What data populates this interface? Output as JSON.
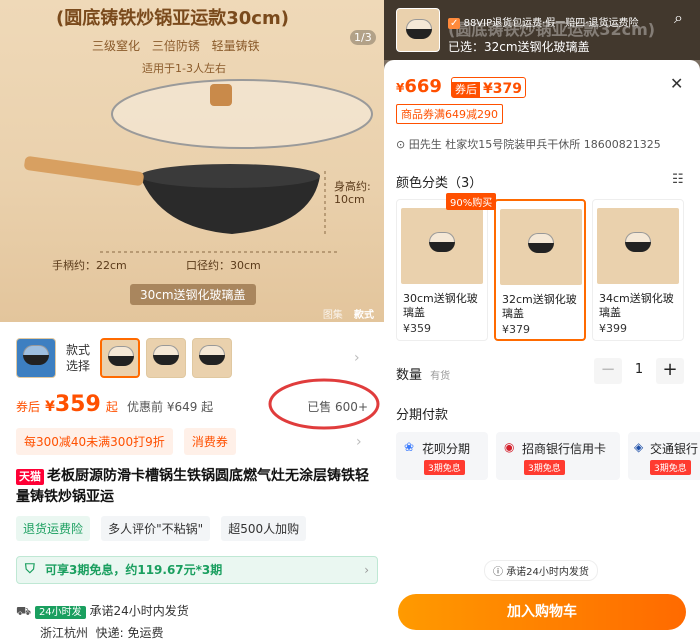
{
  "left": {
    "hero": {
      "title": "(圆底铸铁炒锅亚运款30cm)",
      "features": "三级窒化 三倍防锈 轻量铸铁",
      "suits": "适用于1-3人左右",
      "pager": "1/3",
      "dim_height_label": "身高约:",
      "dim_height_value": "10cm",
      "dim_handle": "手柄约：22cm",
      "dim_mouth": "口径约：30cm",
      "banner": "30cm送钢化玻璃盖",
      "tabs": [
        "图集",
        "款式"
      ]
    },
    "style": {
      "label1": "款式",
      "label2": "选择"
    },
    "price": {
      "after_coupon_label": "券后",
      "currency": "¥",
      "amount": "359",
      "suffix": "起",
      "before_discount": "优惠前 ¥649 起",
      "sold": "已售 600+"
    },
    "promos": [
      "每300减40未满300打9折",
      "消费券"
    ],
    "product_title_badge": "天猫",
    "product_title": "老板厨源防滑卡槽锅生铁锅圆底燃气灶无涂层铸铁轻量铸铁炒锅亚运",
    "tags": [
      "退货运费险",
      "多人评价\"不粘锅\"",
      "超500人加购"
    ],
    "installment": "可享3期免息，约119.67元*3期",
    "shipping": {
      "badge": "24小时发",
      "promise": "承诺24小时内发货",
      "origin": "浙江杭州",
      "express": "快递: 免运费"
    }
  },
  "right": {
    "top": {
      "vip": "88VIP退货包运费·假一赔四·退货运费险",
      "selected": "已选：32cm送钢化玻璃盖",
      "bg_title": "(圆底铸铁炒锅亚运款32cm)"
    },
    "price": {
      "currency": "¥",
      "amount": "669",
      "coupon_label": "券后",
      "coupon_price": "¥379"
    },
    "coupon": "商品券满649减290",
    "address": "田先生 杜家坎15号院装甲兵干休所 18600821325",
    "color_section": {
      "title": "颜色分类（3）",
      "hot": "90%购买"
    },
    "options": [
      {
        "label": "30cm送钢化玻璃盖",
        "price": "¥359"
      },
      {
        "label": "32cm送钢化玻璃盖",
        "price": "¥379"
      },
      {
        "label": "34cm送钢化玻璃盖",
        "price": "¥399"
      }
    ],
    "qty": {
      "label": "数量",
      "stock": "有货",
      "value": "1"
    },
    "installments": {
      "title": "分期付款",
      "items": [
        {
          "name": "花呗分期",
          "badge": "3期免息"
        },
        {
          "name": "招商银行信用卡",
          "badge": "3期免息"
        },
        {
          "name": "交通银行",
          "badge": "3期免息"
        }
      ]
    },
    "promise": "承诺24小时内发货",
    "cart_button": "加入购物车"
  },
  "colors": {
    "accent": "#ff5000",
    "green": "#1a9f5f",
    "cta": "#ff7a00",
    "red_circle": "#e03c3c"
  }
}
